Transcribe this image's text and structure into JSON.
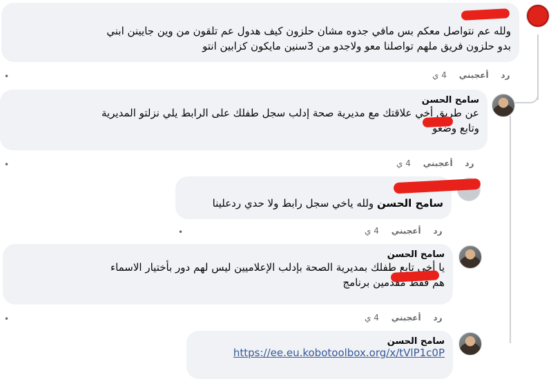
{
  "comments": [
    {
      "author": "",
      "text_lines": [
        "ولله عم نتواصل معكم بس مافي جدوه مشان حلزون كيف هدول عم تلقون من وين جايينن ابني",
        "بدو حلزون فريق ملهم تواصلنا معو ولاجدو من 3سنين مايكون كزابين انتو"
      ],
      "time": "4 ي",
      "like": "أعجبني",
      "reply": "رد"
    },
    {
      "author": "سامح الحسن",
      "text_lines": [
        "عن طريق أخي علاقتك مع مديرية صحة إدلب سجل طفلك على الرابط يلي نزلتو المديرية",
        "وتابع وضعو"
      ],
      "time": "4 ي",
      "like": "أعجبني",
      "reply": "رد"
    },
    {
      "author": "",
      "text_lines": [
        "سامح الحسن ولله ياخي سجل رابط ولا حدي ردعلينا"
      ],
      "mention": "سامح الحسن",
      "time": "4 ي",
      "like": "أعجبني",
      "reply": "رد"
    },
    {
      "author": "سامح الحسن",
      "text_lines": [
        "يا أخي تابع طفلك بمديرية الصحة بإدلب الإعلاميين ليس لهم دور بأختيار الاسماء",
        "هم فقط مقدمين برنامج"
      ],
      "time": "4 ي",
      "like": "أعجبني",
      "reply": "رد"
    },
    {
      "author": "سامح الحسن",
      "link": "https://ee.eu.kobotoolbox.org/x/tVlP1c0P"
    }
  ],
  "dot_symbol": "•",
  "colors": {
    "bubble": "#f0f2f5",
    "redaction": "#e8221b",
    "link": "#385898"
  }
}
